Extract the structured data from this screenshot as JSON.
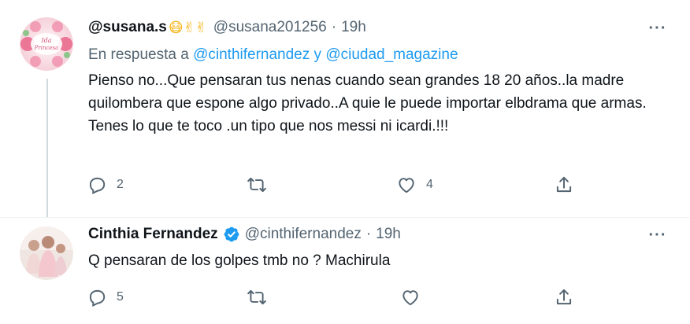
{
  "tweets": [
    {
      "name": "@susana.s",
      "emojis": "😷✌✌",
      "handle": "@susana201256",
      "separator": "·",
      "time": "19h",
      "reply_prefix": "En respuesta a",
      "reply_mention_1": "@cinthifernandez",
      "reply_and": "y",
      "reply_mention_2": "@ciudad_magazine",
      "text": "Pienso no...Que pensaran tus nenas cuando sean grandes 18 20 años..la madre quilombera que espone algo privado..A quie le puede importar elbdrama que armas. Tenes lo que te toco .un tipo que nos messi ni icardi.!!!",
      "reply_count": "2",
      "retweet_count": "",
      "like_count": "4",
      "avatar_text": "Ida Princesa"
    },
    {
      "name": "Cinthia Fernandez",
      "verified": true,
      "handle": "@cinthifernandez",
      "separator": "·",
      "time": "19h",
      "text": "Q pensaran de los golpes tmb no ? Machirula",
      "reply_count": "5",
      "retweet_count": "",
      "like_count": ""
    }
  ],
  "more_label": "···",
  "colors": {
    "link": "#1d9bf0",
    "secondary": "#536471",
    "verified": "#1d9bf0"
  }
}
